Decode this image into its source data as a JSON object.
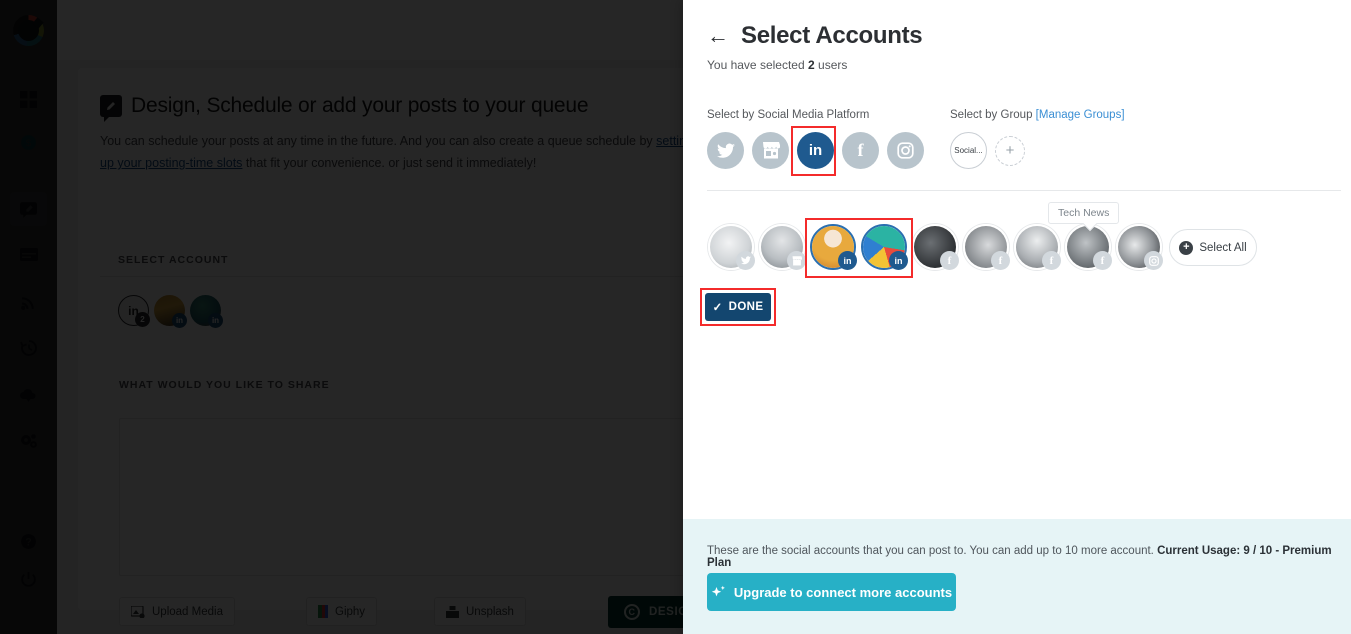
{
  "background_app": {
    "sidebar": {
      "logo_name": "app-logo",
      "items": [
        {
          "name": "dashboard",
          "icon": "grid-icon"
        },
        {
          "name": "rewards",
          "icon": "badge-dollar-icon"
        },
        {
          "name": "compose",
          "icon": "compose-pencil-icon",
          "active": true
        },
        {
          "name": "queue",
          "icon": "list-icon"
        },
        {
          "name": "feeds",
          "icon": "rss-icon"
        },
        {
          "name": "history",
          "icon": "history-clock-icon"
        },
        {
          "name": "uploads",
          "icon": "cloud-download-icon"
        },
        {
          "name": "settings",
          "icon": "gears-icon"
        },
        {
          "name": "help",
          "icon": "question-circle-icon"
        },
        {
          "name": "logout",
          "icon": "power-icon"
        }
      ]
    },
    "page_title": "Design, Schedule or add your posts to your queue",
    "page_subtitle_part1": "You can schedule your posts at any time in the future. And you can also create a queue schedule by ",
    "page_subtitle_link": "setting up your posting-time slots",
    "page_subtitle_part2": " that fit your convenience. or just send it immediately!",
    "select_account_label": "SELECT ACCOUNT",
    "mini_avatars": [
      {
        "label": "in",
        "badge": "2"
      },
      {
        "label": "",
        "badge": "in"
      },
      {
        "label": "",
        "badge": "in"
      }
    ],
    "share_label": "WHAT WOULD YOU LIKE TO SHARE",
    "media_buttons": [
      {
        "label": "Upload Media",
        "icon": "image-upload-icon"
      },
      {
        "label": "Giphy",
        "icon": "giphy-icon"
      },
      {
        "label": "Unsplash",
        "icon": "unsplash-icon"
      }
    ],
    "canva_button": "DESIGN ON CANVA",
    "canva_icon": "canva-c-icon"
  },
  "panel": {
    "back_icon": "back-arrow-icon",
    "title": "Select Accounts",
    "selected_prefix": "You have selected",
    "selected_count": "2",
    "selected_suffix": "users",
    "platform_section_label": "Select by Social Media Platform",
    "group_section_label": "Select by Group",
    "manage_groups_label": "[Manage Groups]",
    "platforms": [
      {
        "name": "twitter",
        "glyph": "🐦",
        "selected": false
      },
      {
        "name": "google-my-business",
        "glyph": "🏪",
        "selected": false
      },
      {
        "name": "linkedin",
        "glyph": "in",
        "selected": true
      },
      {
        "name": "facebook",
        "glyph": "f",
        "selected": false
      },
      {
        "name": "instagram",
        "glyph": "◻",
        "selected": false
      }
    ],
    "groups": [
      {
        "label": "Social...",
        "name": "group-social"
      }
    ],
    "add_group_glyph": "+",
    "accounts": [
      {
        "network": "twitter",
        "net_glyph": "🐦",
        "selected": false,
        "tone": "av-t1"
      },
      {
        "network": "gmb",
        "net_glyph": "▦",
        "selected": false,
        "tone": "av-t2"
      },
      {
        "network": "linkedin",
        "net_glyph": "in",
        "selected": true,
        "tone": "av-t3"
      },
      {
        "network": "linkedin",
        "net_glyph": "in",
        "selected": true,
        "tone": "av-t4"
      },
      {
        "network": "facebook",
        "net_glyph": "f",
        "selected": false,
        "tone": "av-t5"
      },
      {
        "network": "facebook",
        "net_glyph": "f",
        "selected": false,
        "tone": "av-t6"
      },
      {
        "network": "facebook",
        "net_glyph": "f",
        "selected": false,
        "tone": "av-t7"
      },
      {
        "network": "facebook",
        "net_glyph": "f",
        "selected": false,
        "tone": "av-t8"
      },
      {
        "network": "instagram",
        "net_glyph": "◻",
        "selected": false,
        "tone": "av-t9"
      }
    ],
    "tooltip_text": "Tech News",
    "select_all_label": "Select All",
    "select_all_icon": "plus-circle-icon",
    "done_label": "DONE",
    "done_icon": "check-icon",
    "footer_text_plain": "These are the social accounts that you can post to. You can add up to 10 more account.",
    "footer_text_bold": "Current Usage: 9 / 10 - Premium Plan",
    "upgrade_label": "Upgrade to connect more accounts",
    "upgrade_icon": "sparkle-star-icon"
  },
  "colors": {
    "linkedin_blue": "#1f5a8f",
    "done_navy": "#13466f",
    "upgrade_teal": "#27b0c6",
    "footer_bg": "#e6f4f6",
    "highlight_red": "#f42b2b",
    "platform_grey": "#b8c4cc"
  }
}
